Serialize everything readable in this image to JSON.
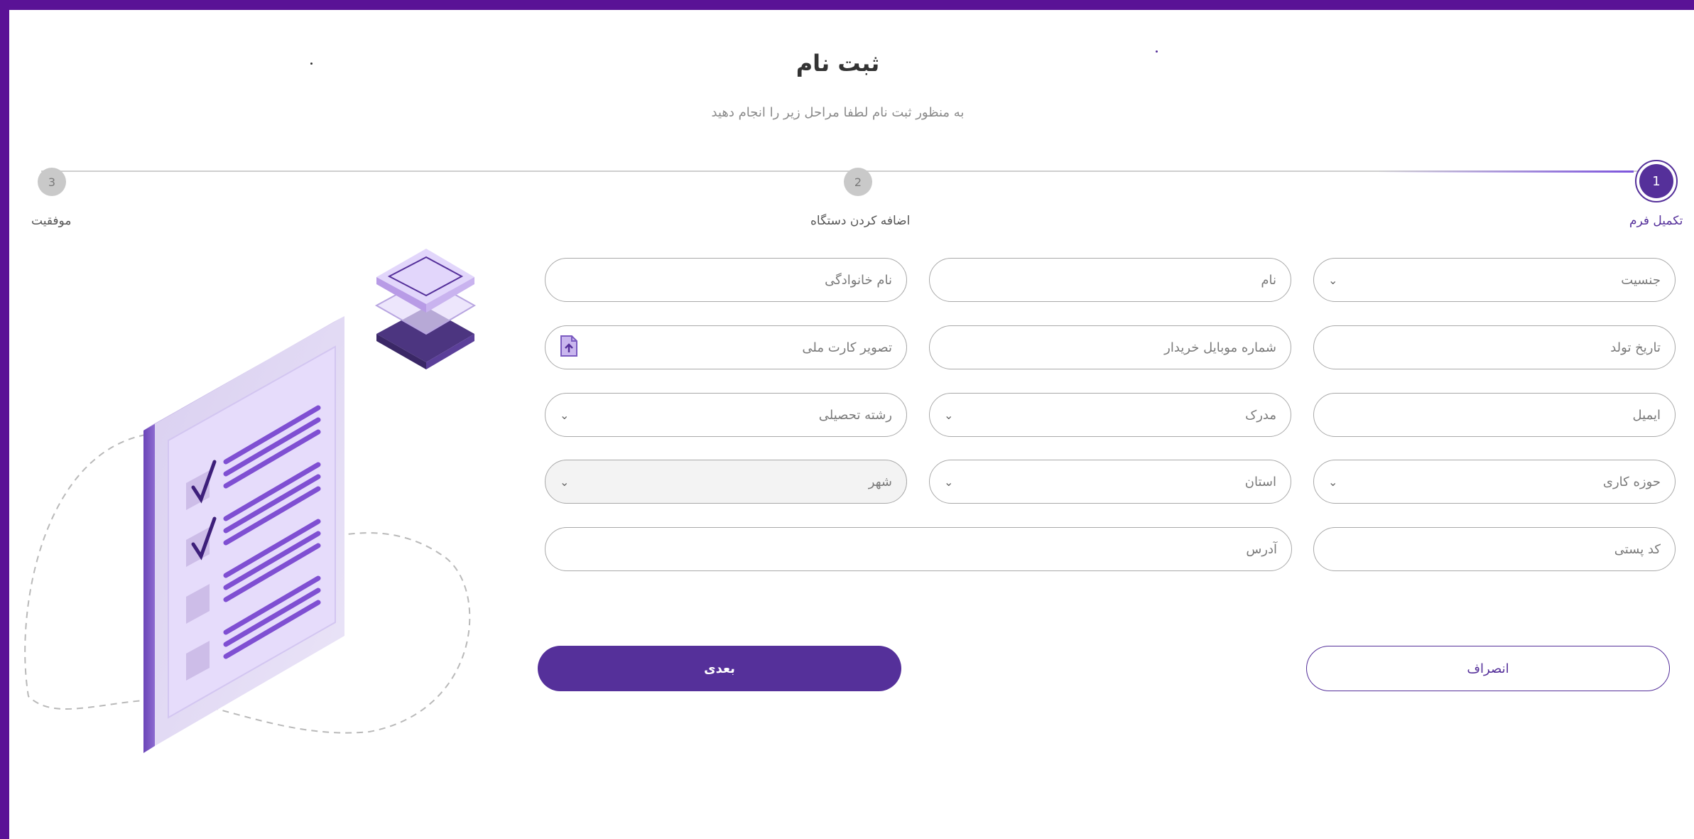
{
  "header": {
    "title": "ثبت نام",
    "subtitle": "به منظور ثبت نام لطفا مراحل زیر را انجام دهید"
  },
  "stepper": {
    "steps": [
      {
        "number": "1",
        "label": "تکمیل فرم",
        "state": "active"
      },
      {
        "number": "2",
        "label": "اضافه کردن دستگاه",
        "state": "inactive"
      },
      {
        "number": "3",
        "label": "موفقیت",
        "state": "inactive"
      }
    ]
  },
  "form": {
    "gender": {
      "placeholder": "جنسیت",
      "type": "select"
    },
    "first_name": {
      "placeholder": "نام",
      "type": "text"
    },
    "last_name": {
      "placeholder": "نام خانوادگی",
      "type": "text"
    },
    "birth_date": {
      "placeholder": "تاریخ تولد",
      "type": "text"
    },
    "mobile": {
      "placeholder": "شماره موبایل خریدار",
      "type": "text"
    },
    "national_card_image": {
      "placeholder": "تصویر کارت ملی",
      "type": "file",
      "icon": "file-upload-icon"
    },
    "email": {
      "placeholder": "ایمیل",
      "type": "text"
    },
    "degree": {
      "placeholder": "مدرک",
      "type": "select"
    },
    "field_of_study": {
      "placeholder": "رشته تحصیلی",
      "type": "select"
    },
    "work_area": {
      "placeholder": "حوزه کاری",
      "type": "select"
    },
    "province": {
      "placeholder": "استان",
      "type": "select"
    },
    "city": {
      "placeholder": "شهر",
      "type": "select",
      "disabled": true
    },
    "postal_code": {
      "placeholder": "کد پستی",
      "type": "text"
    },
    "address": {
      "placeholder": "آدرس",
      "type": "text"
    }
  },
  "buttons": {
    "next": "بعدی",
    "cancel": "انصراف"
  },
  "colors": {
    "primary": "#55309a",
    "frame": "#5a1296",
    "border": "#a9a9a9"
  }
}
